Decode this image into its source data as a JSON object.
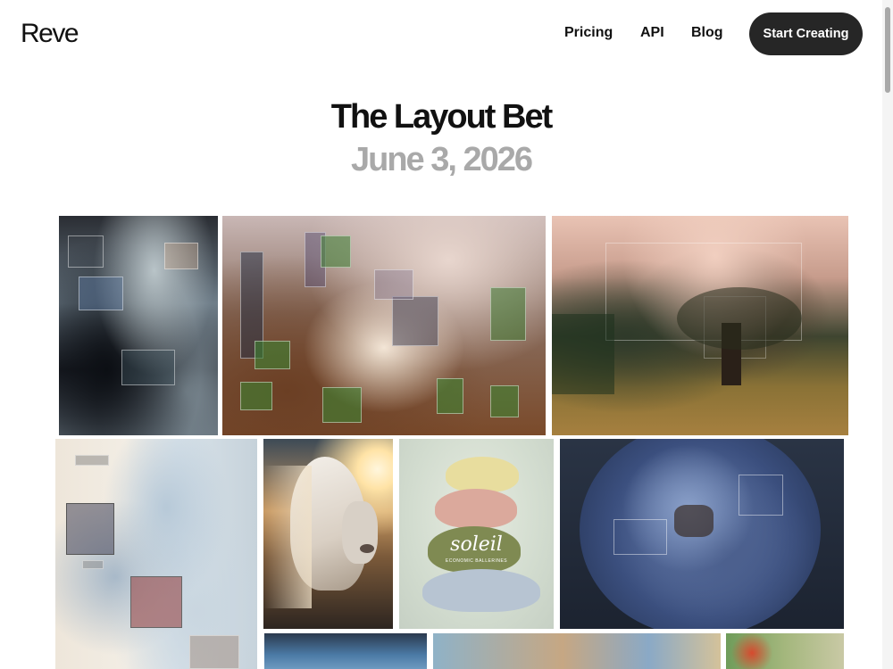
{
  "header": {
    "logo": "Reve",
    "nav": [
      "Pricing",
      "API",
      "Blog"
    ],
    "cta": "Start Creating"
  },
  "article": {
    "title": "The Layout Bet",
    "date": "June 3, 2026"
  },
  "gallery": {
    "shoe_brand": "soleil",
    "shoe_tagline": "ECONOMIC BALLERINES"
  },
  "colors": {
    "cta_background": "#262626",
    "date_gray": "#a9a9a9"
  }
}
